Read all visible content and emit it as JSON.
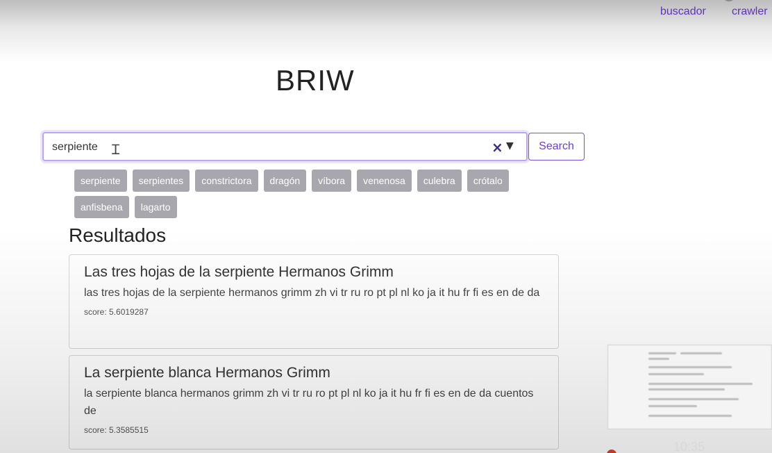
{
  "nav": {
    "links": [
      "buscador",
      "crawler"
    ]
  },
  "brand": "BRIW",
  "search": {
    "query": "serpiente",
    "clear_icon": "×",
    "dropdown_icon": "▼",
    "button_label": "Search"
  },
  "tags": [
    "serpiente",
    "serpientes",
    "constrictora",
    "dragón",
    "víbora",
    "venenosa",
    "culebra",
    "crótalo",
    "anfisbena",
    "lagarto"
  ],
  "results": {
    "heading": "Resultados",
    "items": [
      {
        "title": "Las tres hojas de la serpiente Hermanos Grimm",
        "snippet": "las tres hojas de la serpiente hermanos grimm zh vi tr ru ro pt pl nl ko ja it hu fr fi es en de da",
        "score": "score: 5.6019287"
      },
      {
        "title": "La serpiente blanca Hermanos Grimm",
        "snippet": "la serpiente blanca hermanos grimm zh vi tr ru ro pt pl nl ko ja it hu fr fi es en de da cuentos de",
        "score": "score: 5.3585515"
      }
    ]
  },
  "overlay": {
    "clock": "10:35"
  },
  "colors": {
    "accent": "#6a3fd0",
    "link": "#5b34b8",
    "tag_bg": "#a7a7ad",
    "focus_border": "#b9a8f0"
  }
}
